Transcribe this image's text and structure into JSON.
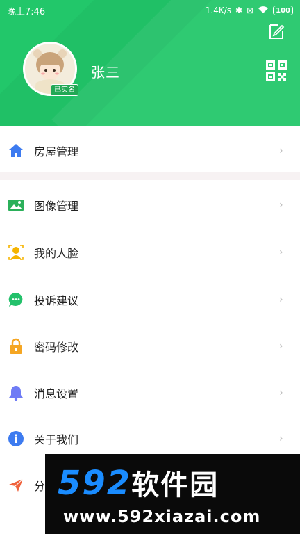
{
  "status_bar": {
    "time": "晚上7:46",
    "net_speed": "1.4K/s",
    "battery": "100"
  },
  "profile": {
    "name": "张三",
    "verified_badge": "已实名"
  },
  "menu": [
    {
      "label": "房屋管理",
      "icon": "home-icon",
      "color": "#3d7bf0"
    },
    {
      "label": "图像管理",
      "icon": "image-icon",
      "color": "#2bb05a"
    },
    {
      "label": "我的人脸",
      "icon": "face-icon",
      "color": "#f5b400"
    },
    {
      "label": "投诉建议",
      "icon": "chat-icon",
      "color": "#23c16b"
    },
    {
      "label": "密码修改",
      "icon": "lock-icon",
      "color": "#f5a623"
    },
    {
      "label": "消息设置",
      "icon": "bell-icon",
      "color": "#6f7cf5"
    },
    {
      "label": "关于我们",
      "icon": "info-icon",
      "color": "#3d7bf0"
    },
    {
      "label": "分",
      "icon": "share-icon",
      "color": "#f0623c"
    }
  ],
  "chevron": "›",
  "watermark": {
    "brand_num": "592",
    "brand_cn": "软件园",
    "url": "www.592xiazai.com"
  },
  "colors": {
    "header_green": "#22c76a",
    "chevron_gray": "#bbbbbb"
  }
}
